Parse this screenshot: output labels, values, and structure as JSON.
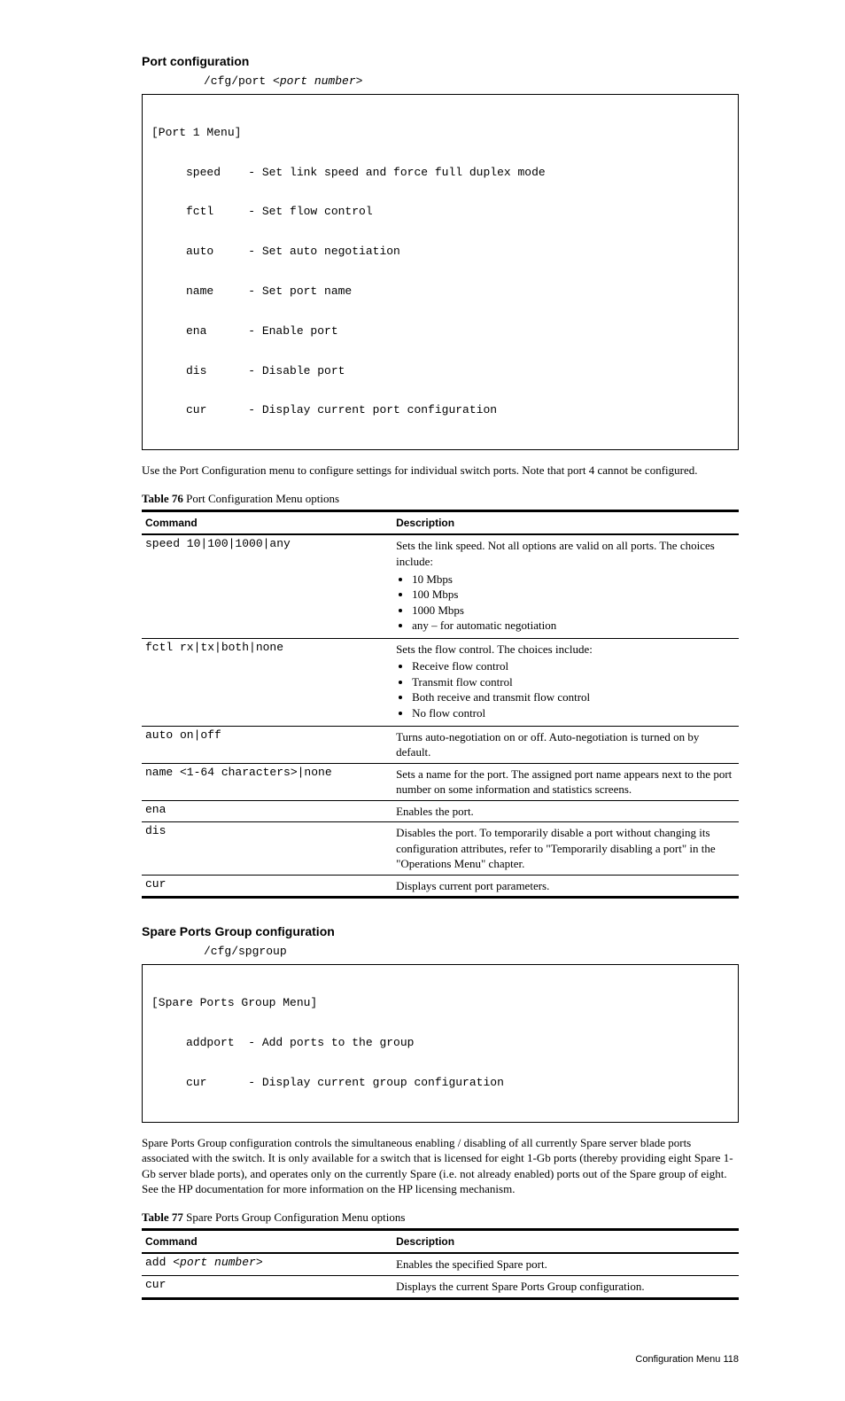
{
  "port_section": {
    "title": "Port configuration",
    "cmd_prefix": "/cfg/port <",
    "cmd_placeholder": "port number",
    "cmd_suffix": ">",
    "menu_lines": [
      "[Port 1 Menu]",
      "     speed    - Set link speed and force full duplex mode",
      "     fctl     - Set flow control",
      "     auto     - Set auto negotiation",
      "     name     - Set port name",
      "     ena      - Enable port",
      "     dis      - Disable port",
      "     cur      - Display current port configuration"
    ],
    "intro": "Use the Port Configuration menu to configure settings for individual switch ports. Note that port 4 cannot be configured.",
    "table_caption": "Port Configuration Menu options",
    "col1": "Command",
    "col2": "Description",
    "rows": [
      {
        "cmd": "speed 10|100|1000|any",
        "desc_main": "Sets the link speed. Not all options are valid on all ports. The choices include:",
        "bullets": [
          "10 Mbps",
          "100 Mbps",
          "1000 Mbps",
          "any – for automatic negotiation"
        ]
      },
      {
        "cmd": "fctl rx|tx|both|none",
        "desc_main": "Sets the flow control. The choices include:",
        "bullets": [
          "Receive flow control",
          "Transmit flow control",
          "Both receive and transmit flow control",
          "No flow control"
        ]
      },
      {
        "cmd": "auto on|off",
        "desc_main": "Turns auto-negotiation on or off. Auto-negotiation is turned on by default."
      },
      {
        "cmd": "name <1-64 characters>|none",
        "desc_main": "Sets a name for the port. The assigned port name appears next to the port number on some information and statistics screens."
      },
      {
        "cmd": "ena",
        "desc_main": "Enables the port."
      },
      {
        "cmd": "dis",
        "desc_main": "Disables the port. To temporarily disable a port without changing its configuration attributes, refer to \"Temporarily disabling a port\" in the \"Operations Menu\" chapter."
      },
      {
        "cmd": "cur",
        "desc_main": "Displays current port parameters."
      }
    ]
  },
  "sp_section": {
    "title": "Spare Ports Group configuration",
    "cmd": "/cfg/spgroup",
    "menu_lines": [
      "[Spare Ports Group Menu]",
      "     addport  - Add ports to the group",
      "     cur      - Display current group configuration"
    ],
    "intro": "Spare Ports Group configuration controls the simultaneous enabling / disabling of all currently Spare server blade ports associated with the switch. It is only available for a switch that is licensed for eight 1-Gb ports (thereby providing eight Spare 1-Gb server blade ports), and operates only on the currently Spare (i.e. not already enabled) ports out of the Spare group of eight. See the HP documentation for more information on the HP licensing mechanism.",
    "table_caption": "Spare Ports Group Configuration Menu options",
    "col1": "Command",
    "col2": "Description",
    "rows": [
      {
        "cmd_pre": "add <",
        "cmd_italic": "port number",
        "cmd_post": ">",
        "desc": "Enables the specified Spare port."
      },
      {
        "cmd": "cur",
        "desc": "Displays the current Spare Ports Group configuration."
      }
    ]
  },
  "footer": {
    "left": "",
    "right": "Configuration Menu  118"
  }
}
